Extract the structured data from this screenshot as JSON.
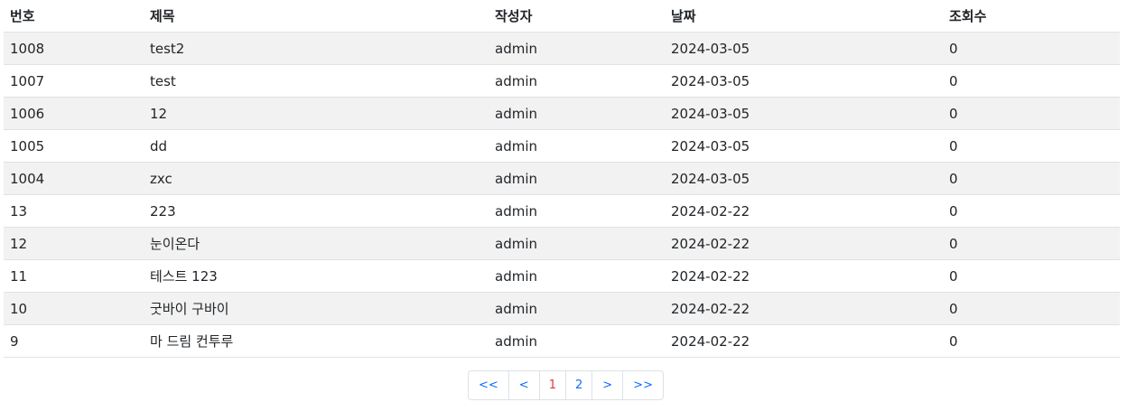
{
  "table": {
    "headers": [
      "번호",
      "제목",
      "작성자",
      "날짜",
      "조회수"
    ],
    "rows": [
      {
        "no": "1008",
        "title": "test2",
        "author": "admin",
        "date": "2024-03-05",
        "views": "0"
      },
      {
        "no": "1007",
        "title": "test",
        "author": "admin",
        "date": "2024-03-05",
        "views": "0"
      },
      {
        "no": "1006",
        "title": "12",
        "author": "admin",
        "date": "2024-03-05",
        "views": "0"
      },
      {
        "no": "1005",
        "title": "dd",
        "author": "admin",
        "date": "2024-03-05",
        "views": "0"
      },
      {
        "no": "1004",
        "title": "zxc",
        "author": "admin",
        "date": "2024-03-05",
        "views": "0"
      },
      {
        "no": "13",
        "title": "223",
        "author": "admin",
        "date": "2024-02-22",
        "views": "0"
      },
      {
        "no": "12",
        "title": "눈이온다",
        "author": "admin",
        "date": "2024-02-22",
        "views": "0"
      },
      {
        "no": "11",
        "title": "테스트 123",
        "author": "admin",
        "date": "2024-02-22",
        "views": "0"
      },
      {
        "no": "10",
        "title": "굿바이 구바이",
        "author": "admin",
        "date": "2024-02-22",
        "views": "0"
      },
      {
        "no": "9",
        "title": "마 드림 컨투루",
        "author": "admin",
        "date": "2024-02-22",
        "views": "0"
      }
    ]
  },
  "pagination": {
    "first": "<<",
    "prev": "<",
    "pages": [
      "1",
      "2"
    ],
    "current_page": "1",
    "next": ">",
    "last": ">>"
  },
  "colors": {
    "stripe": "#f2f2f2",
    "link": "#0d6efd",
    "current": "#dc3545",
    "border": "#dee2e6"
  }
}
